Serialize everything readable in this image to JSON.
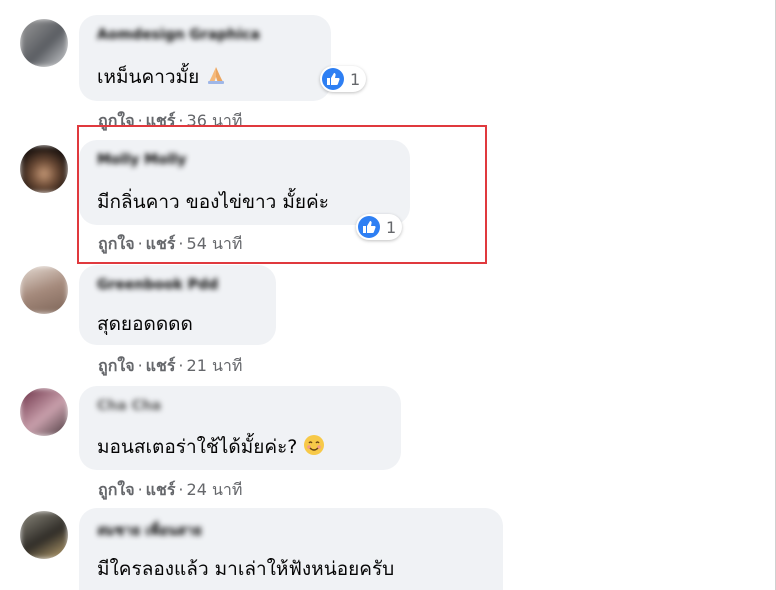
{
  "comments": [
    {
      "author": "Aomdesign Graphica",
      "text": "เหม็นคาวมั้ย",
      "emoji": "praying-hands",
      "reactions": "1",
      "like": "ถูกใจ",
      "share": "แชร์",
      "time": "36 นาที"
    },
    {
      "author": "Molly Molly",
      "text": "มีกลิ่นคาว ของไข่ขาว มั้ยค่ะ",
      "reactions": "1",
      "like": "ถูกใจ",
      "share": "แชร์",
      "time": "54 นาที"
    },
    {
      "author": "Greenbook Pdd",
      "text": "สุดยอดดดด",
      "like": "ถูกใจ",
      "share": "แชร์",
      "time": "21 นาที"
    },
    {
      "author": "Cha Cha",
      "text": "มอนสเตอร่าใช้ได้มั้ยค่ะ?",
      "emoji": "smiling-face",
      "like": "ถูกใจ",
      "share": "แชร์",
      "time": "24 นาที"
    },
    {
      "author": "สมชาย เพื่อนสาย",
      "text": "มีใครลองแล้ว มาเล่าให้ฟังหน่อยครับ"
    }
  ],
  "separator": "·",
  "colors": {
    "bubble": "#f0f2f5",
    "like_blue": "#2e7ff3",
    "meta_gray": "#65676b",
    "highlight_red": "#e0393e"
  }
}
